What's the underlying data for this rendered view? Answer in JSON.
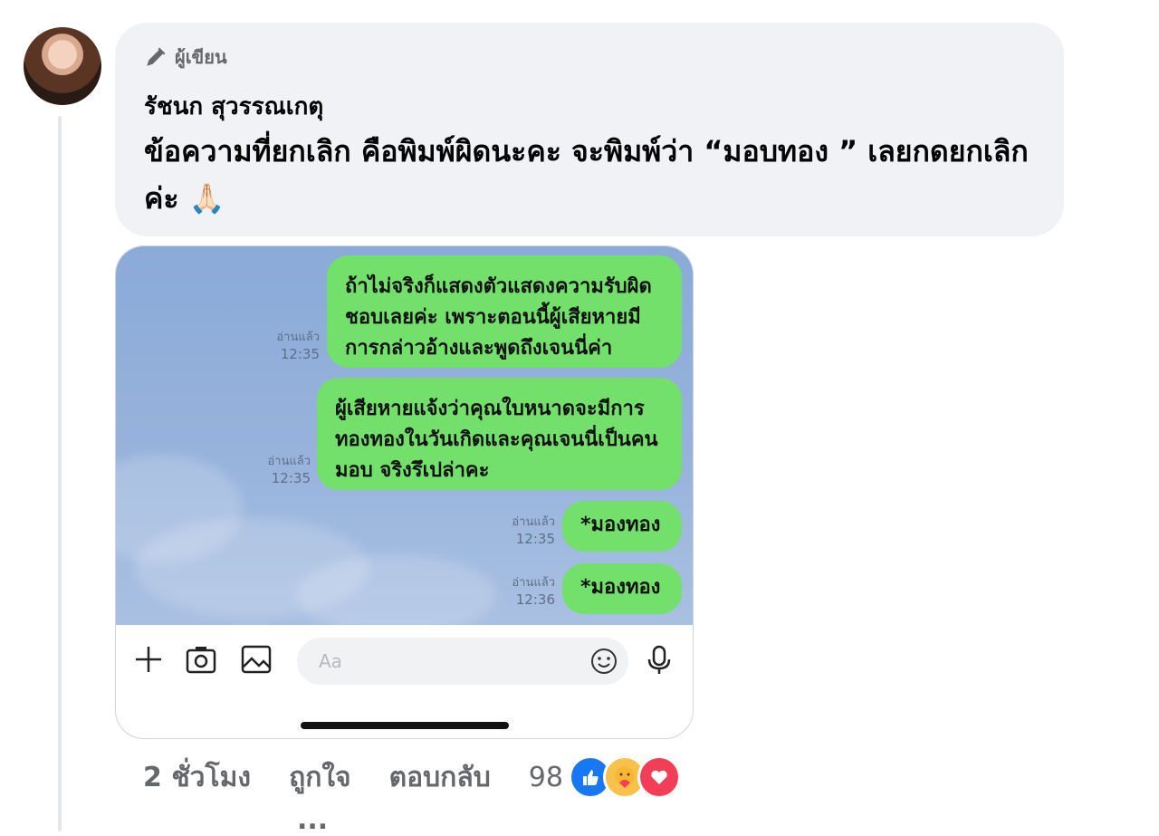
{
  "comment": {
    "badge_label": "ผู้เขียน",
    "author": "รัชนก สุวรรณเกตุ",
    "text": "ข้อความที่ยกเลิก คือพิมพ์ผิดนะคะ จะพิมพ์ว่า “มอบทอง ” เลยกดยกเลิกค่ะ 🙏🏻"
  },
  "screenshot": {
    "messages": [
      {
        "text": "ถ้าไม่จริงก็แสดงตัวแสดงความรับผิดชอบเลยค่ะ เพราะตอนนี้ผู้เสียหายมีการกล่าวอ้างและพูดถึงเจนนี่ค่า",
        "status": "อ่านแล้ว",
        "time": "12:35"
      },
      {
        "text": "ผู้เสียหายแจ้งว่าคุณใบหนาดจะมีการทองทองในวันเกิดและคุณเจนนี่เป็นคนมอบ จริงรึเปล่าคะ",
        "status": "อ่านแล้ว",
        "time": "12:35"
      },
      {
        "text": "*มองทอง",
        "status": "อ่านแล้ว",
        "time": "12:35"
      },
      {
        "text": "*มองทอง",
        "status": "อ่านแล้ว",
        "time": "12:36"
      }
    ],
    "input_placeholder": "Aa"
  },
  "actions": {
    "time": "2 ชั่วโมง",
    "like": "ถูกใจ",
    "reply": "ตอบกลับ",
    "reaction_count": "98",
    "reactions": [
      "like-icon",
      "care-icon",
      "love-icon"
    ]
  },
  "colors": {
    "bubble_bg": "#f0f2f5",
    "chat_green": "#72e06a",
    "like_blue": "#1877f2",
    "love_red": "#f33e58"
  }
}
